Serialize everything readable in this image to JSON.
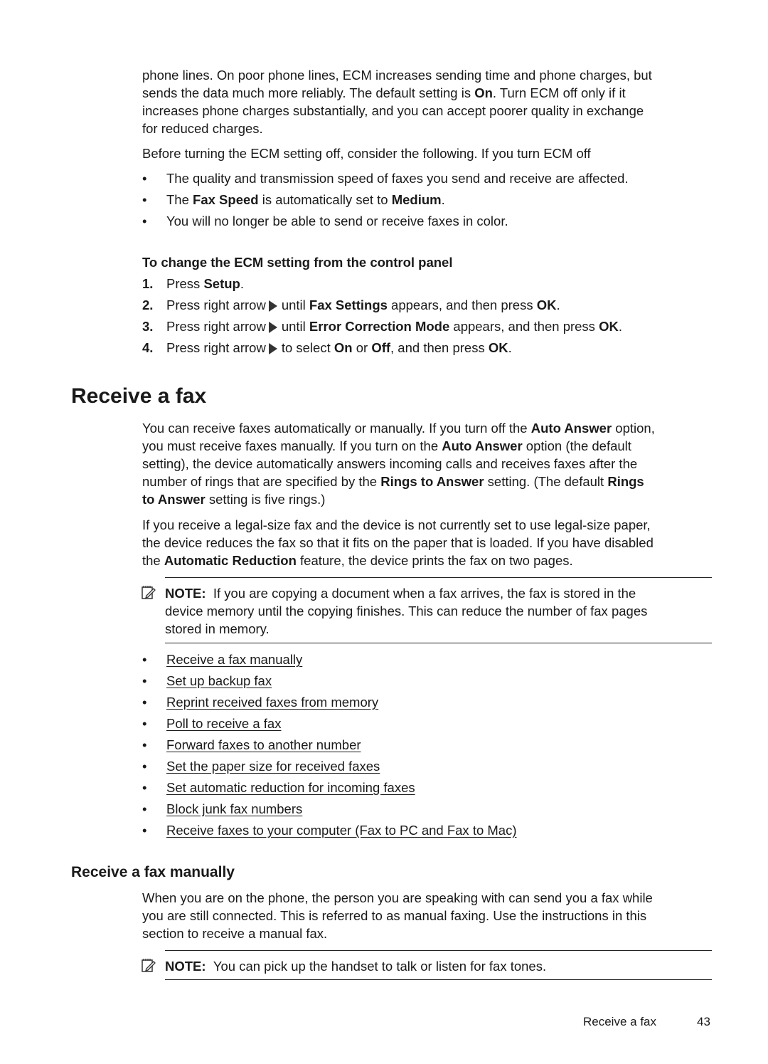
{
  "intro": {
    "p1_lines": [
      "phone lines. On poor phone lines, ECM increases sending time and phone charges, but",
      [
        "sends the data much more reliably. The default setting is ",
        {
          "b": "On"
        },
        ". Turn ECM off only if it"
      ],
      "increases phone charges substantially, and you can accept poorer quality in exchange",
      "for reduced charges."
    ],
    "p2": "Before turning the ECM setting off, consider the following. If you turn ECM off",
    "bullets": [
      {
        "parts": [
          "The quality and transmission speed of faxes you send and receive are affected."
        ]
      },
      {
        "parts": [
          "The ",
          {
            "b": "Fax Speed"
          },
          " is automatically set to ",
          {
            "b": "Medium"
          },
          "."
        ]
      },
      {
        "parts": [
          "You will no longer be able to send or receive faxes in color."
        ]
      }
    ]
  },
  "ecm_procedure": {
    "heading": "To change the ECM setting from the control panel",
    "steps": [
      {
        "num": "1.",
        "parts": [
          "Press ",
          {
            "b": "Setup"
          },
          "."
        ]
      },
      {
        "num": "2.",
        "parts": [
          "Press right arrow",
          {
            "icon": "right-arrow"
          },
          "until ",
          {
            "b": "Fax Settings"
          },
          " appears, and then press ",
          {
            "b": "OK"
          },
          "."
        ]
      },
      {
        "num": "3.",
        "parts": [
          "Press right arrow",
          {
            "icon": "right-arrow"
          },
          "until ",
          {
            "b": "Error Correction Mode"
          },
          " appears, and then press ",
          {
            "b": "OK"
          },
          "."
        ]
      },
      {
        "num": "4.",
        "parts": [
          "Press right arrow",
          {
            "icon": "right-arrow"
          },
          "to select ",
          {
            "b": "On"
          },
          " or ",
          {
            "b": "Off"
          },
          ", and then press ",
          {
            "b": "OK"
          },
          "."
        ]
      }
    ]
  },
  "receive_fax": {
    "title": "Receive a fax",
    "p1_lines": [
      [
        "You can receive faxes automatically or manually. If you turn off the ",
        {
          "b": "Auto Answer"
        },
        " option,"
      ],
      [
        "you must receive faxes manually. If you turn on the ",
        {
          "b": "Auto Answer"
        },
        " option (the default"
      ],
      [
        "setting), the device automatically answers incoming calls and receives faxes after the"
      ],
      [
        "number of rings that are specified by the ",
        {
          "b": "Rings to Answer"
        },
        " setting. (The default ",
        {
          "b": "Rings"
        }
      ],
      [
        {
          "b": "to Answer"
        },
        " setting is five rings.)"
      ]
    ],
    "p2_lines": [
      [
        "If you receive a legal-size fax and the device is not currently set to use legal-size paper,"
      ],
      [
        "the device reduces the fax so that it fits on the paper that is loaded. If you have disabled"
      ],
      [
        "the ",
        {
          "b": "Automatic Reduction"
        },
        " feature, the device prints the fax on two pages."
      ]
    ],
    "note": {
      "label": "NOTE:",
      "lines": [
        "If you are copying a document when a fax arrives, the fax is stored in the",
        "device memory until the copying finishes. This can reduce the number of fax pages",
        "stored in memory."
      ]
    },
    "links": [
      "Receive a fax manually",
      "Set up backup fax",
      "Reprint received faxes from memory",
      "Poll to receive a fax",
      "Forward faxes to another number",
      "Set the paper size for received faxes",
      "Set automatic reduction for incoming faxes",
      "Block junk fax numbers",
      "Receive faxes to your computer (Fax to PC and Fax to Mac)"
    ]
  },
  "receive_manually": {
    "title": "Receive a fax manually",
    "p_lines": [
      "When you are on the phone, the person you are speaking with can send you a fax while",
      "you are still connected. This is referred to as manual faxing. Use the instructions in this",
      "section to receive a manual fax."
    ],
    "note": {
      "label": "NOTE:",
      "text": "You can pick up the handset to talk or listen for fax tones."
    }
  },
  "footer": {
    "section": "Receive a fax",
    "page_number": "43"
  }
}
